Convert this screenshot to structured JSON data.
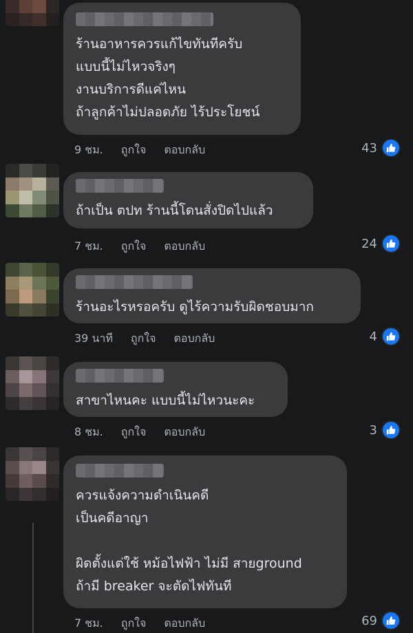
{
  "comments": [
    {
      "lines": [
        "ร้านอาหารควรแก้ไขทันทีครับ",
        "แบบนี้ไม่ไหวจริงๆ",
        "งานบริการดีแค่ไหน",
        "ถ้าลูกค้าไม่ปลอดภัย ไร้ประโยชน์"
      ],
      "time": "9 ชม.",
      "like_label": "ถูกใจ",
      "reply_label": "ตอบกลับ",
      "likes": "43"
    },
    {
      "lines": [
        "ถ้าเป็น ตปท ร้านนี้โดนสั่งปิดไปแล้ว"
      ],
      "time": "7 ชม.",
      "like_label": "ถูกใจ",
      "reply_label": "ตอบกลับ",
      "likes": "24"
    },
    {
      "lines": [
        "ร้านอะไรหรอครับ ดูไร้ความรับผิดชอบมาก"
      ],
      "time": "39 นาที",
      "like_label": "ถูกใจ",
      "reply_label": "ตอบกลับ",
      "likes": "4"
    },
    {
      "lines": [
        "สาขาไหนคะ แบบนี้ไม่ไหวนะคะ"
      ],
      "time": "8 ชม.",
      "like_label": "ถูกใจ",
      "reply_label": "ตอบกลับ",
      "likes": "3"
    },
    {
      "lines": [
        "ควรแจ้งความดำเนินคดี",
        "เป็นคดีอาญา",
        "",
        "ผิดตั้งแต่ใช้ หม้อไฟฟ้า ไม่มี สายground",
        "ถ้ามี breaker จะตัดไฟทันที"
      ],
      "time": "7 ชม.",
      "like_label": "ถูกใจ",
      "reply_label": "ตอบกลับ",
      "likes": "69"
    }
  ],
  "colors": {
    "background": "#18191a",
    "bubble": "#3a3b3c",
    "like_blue": "#1877f2",
    "meta_text": "#b0b3b8"
  }
}
